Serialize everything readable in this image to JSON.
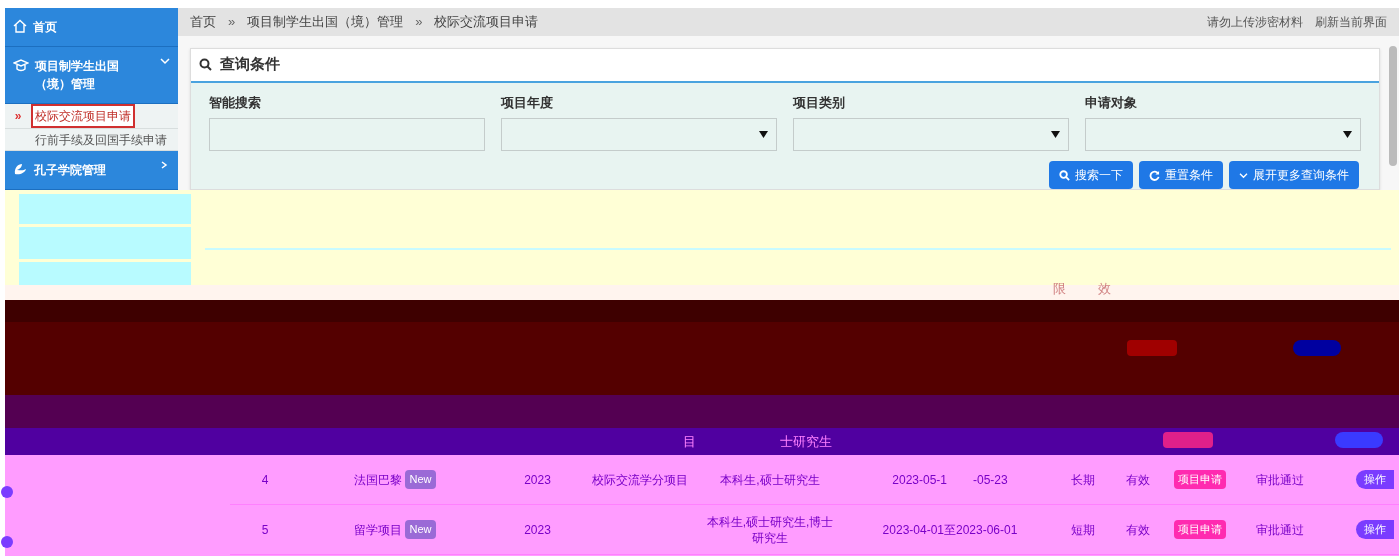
{
  "sidebar": {
    "items": [
      {
        "label": "首页",
        "kind": "home"
      },
      {
        "label": "项目制学生出国（境）管理",
        "kind": "cap",
        "expanded": true,
        "children": [
          {
            "label": "校际交流项目申请",
            "selected": true
          },
          {
            "label": "行前手续及回国手续申请",
            "selected": false
          }
        ]
      },
      {
        "label": "孔子学院管理",
        "kind": "leaf",
        "expanded": false
      }
    ]
  },
  "breadcrumb": {
    "separator": "»",
    "items": [
      "首页",
      "项目制学生出国（境）管理",
      "校际交流项目申请"
    ]
  },
  "header_links": [
    "请勿上传涉密材料",
    "刷新当前界面"
  ],
  "query": {
    "title": "查询条件",
    "fields": [
      {
        "label": "智能搜索",
        "kind": "text"
      },
      {
        "label": "项目年度",
        "kind": "select"
      },
      {
        "label": "项目类别",
        "kind": "select"
      },
      {
        "label": "申请对象",
        "kind": "select"
      }
    ],
    "buttons": [
      {
        "label": "搜索一下",
        "kind": "search"
      },
      {
        "label": "重置条件",
        "kind": "reset"
      },
      {
        "label": "展开更多查询条件",
        "kind": "expand"
      }
    ]
  },
  "table": {
    "header_fragments": [
      "限",
      "效"
    ],
    "row_fragments": [
      "目",
      "士研究生"
    ],
    "rows": [
      {
        "index": "4",
        "name": "法国巴黎",
        "badge": "New",
        "year": "2023",
        "category": "校际交流学分项目",
        "target": "本科生,硕士研究生",
        "date": [
          "2023-05-1",
          "-05-23"
        ],
        "term": "长期",
        "validity": "有效",
        "type": "项目申请",
        "status": "审批通过",
        "action": "操作"
      },
      {
        "index": "5",
        "name": "留学项目",
        "badge": "New",
        "year": "2023",
        "target": "本科生,硕士研究生,博士研究生",
        "date": [
          "2023-04-01至2023-06-01"
        ],
        "term": "短期",
        "validity": "有效",
        "type": "项目申请",
        "status": "审批通过",
        "action": "操作"
      }
    ]
  }
}
